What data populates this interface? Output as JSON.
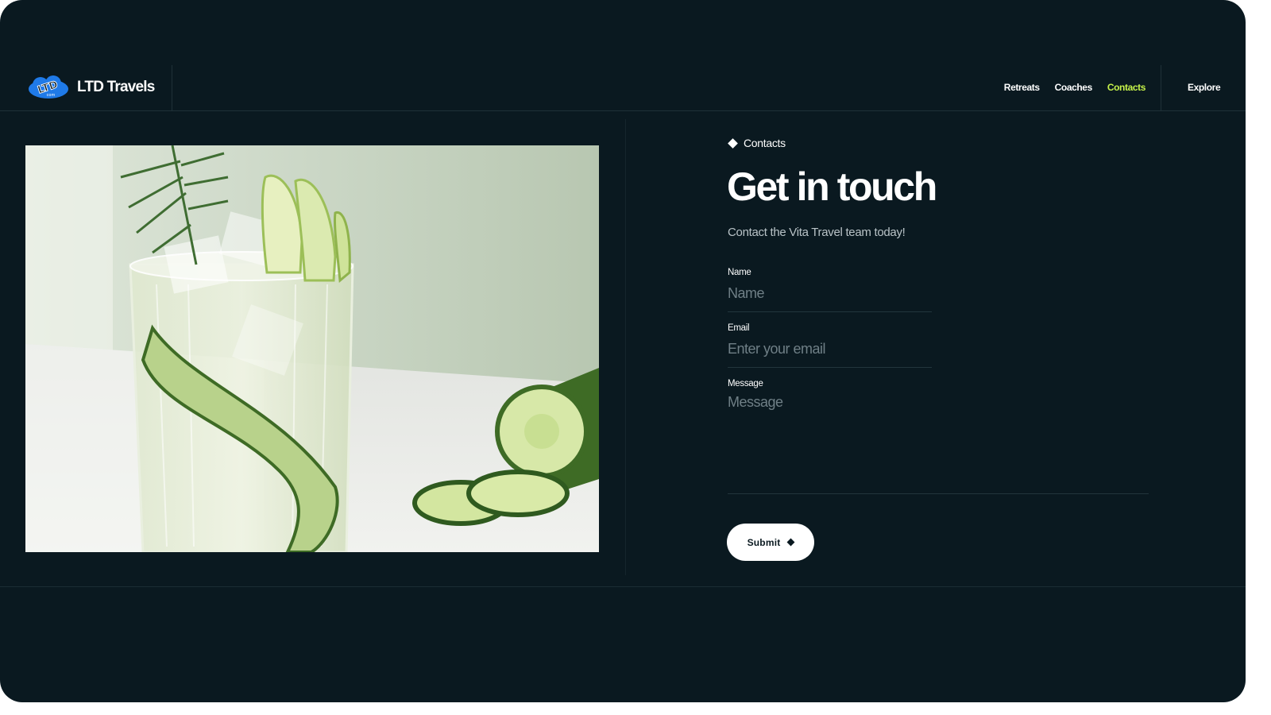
{
  "brand": {
    "logo_text": "LTD",
    "logo_subtext": "com",
    "name": "LTD Travels",
    "logo_color": "#1f7ae8"
  },
  "nav": {
    "items": [
      {
        "label": "Retreats",
        "active": false
      },
      {
        "label": "Coaches",
        "active": false
      },
      {
        "label": "Contacts",
        "active": true
      }
    ],
    "explore_label": "Explore",
    "active_color": "#c6f24a"
  },
  "hero_image": {
    "icon": "cocktail-photo",
    "description_shown": false
  },
  "contact": {
    "eyebrow": "Contacts",
    "title": "Get in touch",
    "subtitle": "Contact the Vita Travel team today!",
    "fields": {
      "name": {
        "label": "Name",
        "placeholder": "Name",
        "value": ""
      },
      "email": {
        "label": "Email",
        "placeholder": "Enter your email",
        "value": ""
      },
      "message": {
        "label": "Message",
        "placeholder": "Message",
        "value": ""
      }
    },
    "submit_label": "Submit"
  },
  "colors": {
    "background": "#0a1920",
    "text": "#ffffff",
    "muted": "#b9c3c7",
    "placeholder": "#6f7f86"
  }
}
